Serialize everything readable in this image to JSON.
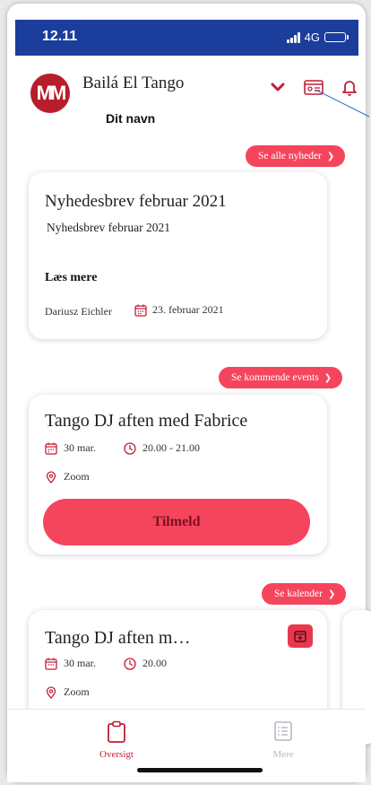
{
  "status_bar": {
    "time": "12.11",
    "network": "4G"
  },
  "header": {
    "avatar_initials": "MM",
    "app_title": "Bailá El Tango",
    "user_name": "Dit navn",
    "icons": [
      "chevron-down-icon",
      "id-card-icon",
      "bell-icon"
    ]
  },
  "news": {
    "see_all_label": "Se alle nyheder",
    "card": {
      "title": "Nyhedesbrev februar 2021",
      "subtitle": "Nyhedsbrev februar 2021",
      "read_more": "Læs mere",
      "author": "Dariusz Eichler",
      "date": "23. februar 2021"
    }
  },
  "events": {
    "see_upcoming_label": "Se kommende events",
    "card": {
      "title": "Tango DJ aften med Fabrice",
      "date": "30 mar.",
      "time": "20.00 - 21.00",
      "location": "Zoom",
      "signup_label": "Tilmeld"
    }
  },
  "calendar": {
    "see_calendar_label": "Se kalender",
    "card": {
      "title": "Tango DJ aften m…",
      "date": "30 mar.",
      "time": "20.00",
      "location": "Zoom"
    }
  },
  "tabbar": {
    "tabs": [
      {
        "label": "Oversigt",
        "icon": "clipboard-icon",
        "active": true
      },
      {
        "label": "Mere",
        "icon": "list-icon",
        "active": false
      }
    ]
  },
  "colors": {
    "accent": "#f5455d",
    "brand_red": "#c21d35",
    "status_bar": "#1b3d9c"
  }
}
